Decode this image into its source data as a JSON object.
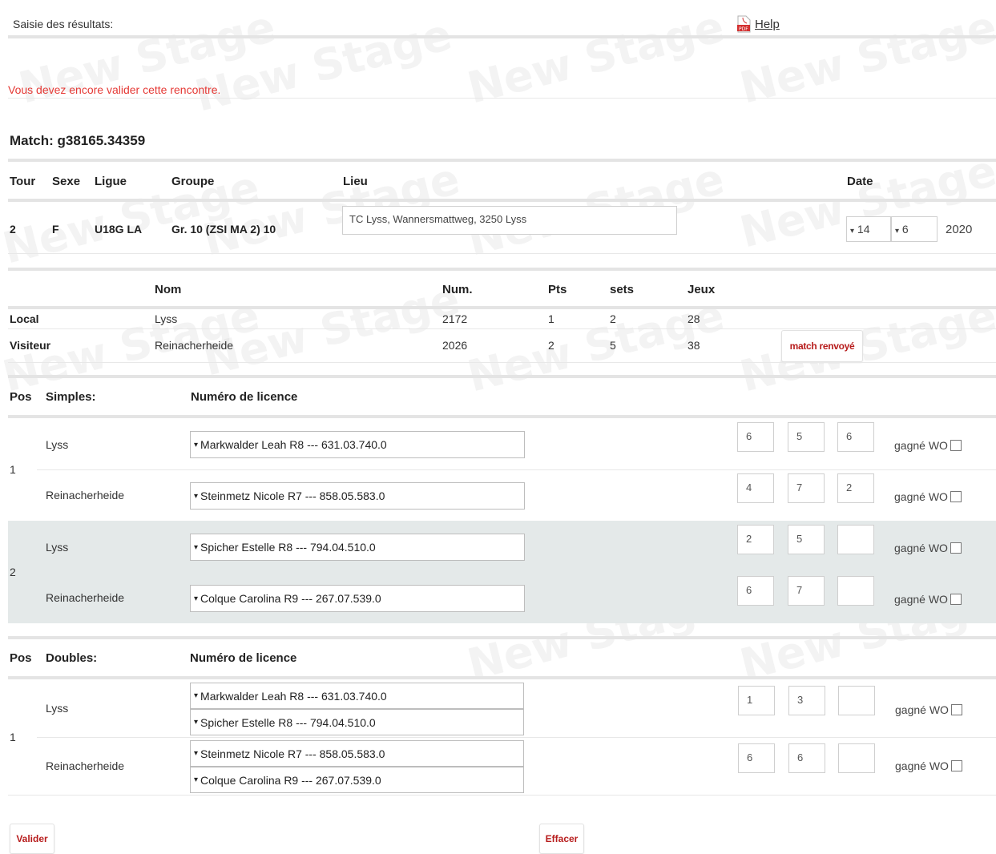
{
  "header": {
    "title": "Saisie des résultats:",
    "help_label": "Help",
    "pdf_icon": "pdf-icon"
  },
  "alert": "Vous devez encore valider cette rencontre.",
  "match": {
    "label": "Match:",
    "id": "g38165.34359"
  },
  "info": {
    "headers": {
      "tour": "Tour",
      "sexe": "Sexe",
      "ligue": "Ligue",
      "groupe": "Groupe",
      "lieu": "Lieu",
      "date": "Date"
    },
    "values": {
      "tour": "2",
      "sexe": "F",
      "ligue": "U18G LA",
      "groupe": "Gr. 10 (ZSI MA 2) 10",
      "lieu": "TC Lyss, Wannersmattweg, 3250 Lyss",
      "day": "14",
      "month": "6",
      "year": "2020"
    }
  },
  "teams": {
    "headers": {
      "nom": "Nom",
      "num": "Num.",
      "pts": "Pts",
      "sets": "sets",
      "jeux": "Jeux"
    },
    "rows": [
      {
        "role": "Local",
        "nom": "Lyss",
        "num": "2172",
        "pts": "1",
        "sets": "2",
        "jeux": "28"
      },
      {
        "role": "Visiteur",
        "nom": "Reinacherheide",
        "num": "2026",
        "pts": "2",
        "sets": "5",
        "jeux": "38"
      }
    ],
    "renvoye_label": "match renvoyé"
  },
  "singles": {
    "headers": {
      "pos": "Pos",
      "type": "Simples:",
      "licence": "Numéro de licence"
    },
    "matches": [
      {
        "pos": "1",
        "home": {
          "club": "Lyss",
          "player": "Markwalder Leah R8 --- 631.03.740.0",
          "scores": [
            "6",
            "5",
            "6"
          ]
        },
        "away": {
          "club": "Reinacherheide",
          "player": "Steinmetz Nicole R7 --- 858.05.583.0",
          "scores": [
            "4",
            "7",
            "2"
          ]
        }
      },
      {
        "pos": "2",
        "home": {
          "club": "Lyss",
          "player": "Spicher Estelle R8 --- 794.04.510.0",
          "scores": [
            "2",
            "5",
            ""
          ]
        },
        "away": {
          "club": "Reinacherheide",
          "player": "Colque Carolina R9 --- 267.07.539.0",
          "scores": [
            "6",
            "7",
            ""
          ]
        }
      }
    ]
  },
  "doubles": {
    "headers": {
      "pos": "Pos",
      "type": "Doubles:",
      "licence": "Numéro de licence"
    },
    "matches": [
      {
        "pos": "1",
        "home": {
          "club": "Lyss",
          "players": [
            "Markwalder Leah R8 --- 631.03.740.0",
            "Spicher Estelle R8 --- 794.04.510.0"
          ],
          "scores": [
            "1",
            "3",
            ""
          ]
        },
        "away": {
          "club": "Reinacherheide",
          "players": [
            "Steinmetz Nicole R7 --- 858.05.583.0",
            "Colque Carolina R9 --- 267.07.539.0"
          ],
          "scores": [
            "6",
            "6",
            ""
          ]
        }
      }
    ]
  },
  "wo_label": "gagné WO",
  "actions": {
    "validate": "Valider",
    "clear": "Effacer"
  },
  "colors": {
    "alert": "#e53935",
    "button_text": "#b71c1c",
    "shade": "#e4e9e9"
  }
}
